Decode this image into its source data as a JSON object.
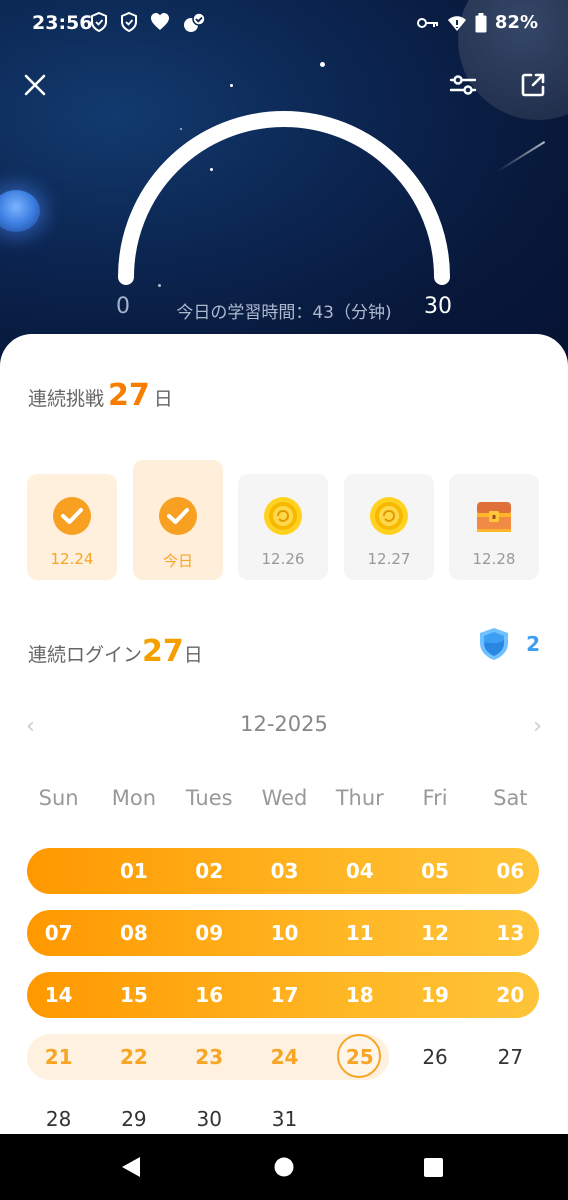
{
  "status_bar": {
    "time": "23:56",
    "battery": "82%"
  },
  "gauge": {
    "min_label": "0",
    "max_label": "30",
    "caption": "今日の学習時間：43（分钟)",
    "progress_fraction": 1.0
  },
  "streak": {
    "prefix": "連続挑戦",
    "count": "27",
    "suffix": "日",
    "days": [
      {
        "label": "12.24",
        "state": "done",
        "icon": "check-circle-icon"
      },
      {
        "label": "今日",
        "state": "today-done",
        "icon": "check-circle-icon"
      },
      {
        "label": "12.26",
        "state": "upcoming",
        "icon": "coin-icon"
      },
      {
        "label": "12.27",
        "state": "upcoming",
        "icon": "coin-icon"
      },
      {
        "label": "12.28",
        "state": "upcoming",
        "icon": "treasure-chest-icon"
      }
    ]
  },
  "login": {
    "prefix": "連続ログイン",
    "count": "27",
    "suffix": "日",
    "shield_count": "2"
  },
  "calendar": {
    "month_label": "12-2025",
    "weekdays": [
      "Sun",
      "Mon",
      "Tues",
      "Wed",
      "Thur",
      "Fri",
      "Sat"
    ],
    "weeks": [
      [
        "",
        "01",
        "02",
        "03",
        "04",
        "05",
        "06"
      ],
      [
        "07",
        "08",
        "09",
        "10",
        "11",
        "12",
        "13"
      ],
      [
        "14",
        "15",
        "16",
        "17",
        "18",
        "19",
        "20"
      ],
      [
        "21",
        "22",
        "23",
        "24",
        "25",
        "26",
        "27"
      ],
      [
        "28",
        "29",
        "30",
        "31",
        "",
        "",
        ""
      ]
    ],
    "today": "25"
  },
  "colors": {
    "accent_orange": "#f77d00",
    "streak_gold": "#ffb623",
    "shield_blue": "#3b9ef0"
  }
}
